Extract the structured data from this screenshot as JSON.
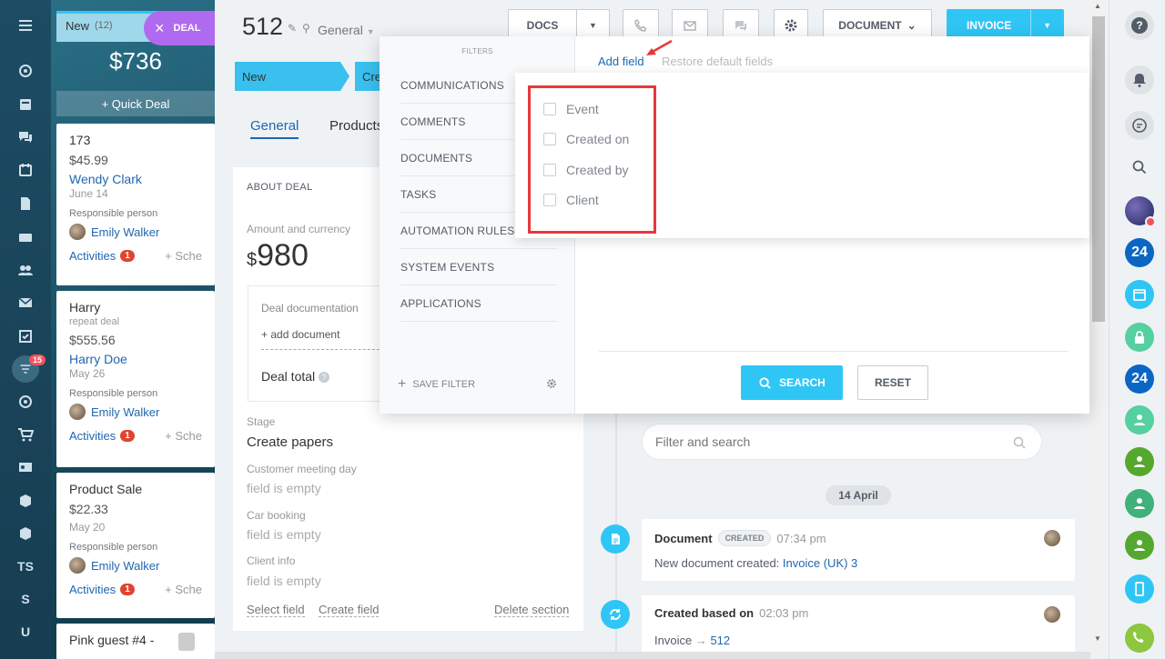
{
  "left_nav": {
    "badge": "15",
    "ts_label": "TS",
    "s_label": "S",
    "u_label": "U"
  },
  "kanban": {
    "column_title": "New",
    "column_count": "(12)",
    "total": "$736",
    "quick_deal": "+ Quick Deal",
    "deal_chip": "DEAL",
    "cards": [
      {
        "title": "173",
        "price": "$45.99",
        "contact": "Wendy Clark",
        "date": "June 14",
        "resp_label": "Responsible person",
        "resp_name": "Emily Walker",
        "activities": "Activities",
        "activities_count": "1",
        "schedule": "+ Sche"
      },
      {
        "title": "Harry",
        "subtitle": "repeat deal",
        "price": "$555.56",
        "contact": "Harry Doe",
        "date": "May 26",
        "resp_label": "Responsible person",
        "resp_name": "Emily Walker",
        "activities": "Activities",
        "activities_count": "1",
        "schedule": "+ Sche"
      },
      {
        "title": "Product Sale",
        "price": "$22.33",
        "date": "May 20",
        "resp_label": "Responsible person",
        "resp_name": "Emily Walker",
        "activities": "Activities",
        "activities_count": "1",
        "schedule": "+ Sche"
      },
      {
        "title": "Pink guest #4 -"
      }
    ]
  },
  "deal": {
    "id": "512",
    "category": "General",
    "buttons": {
      "docs": "DOCS",
      "document": "DOCUMENT",
      "invoice": "INVOICE"
    },
    "stages": [
      "New",
      "Cre"
    ],
    "tabs": [
      "General",
      "Products"
    ],
    "about": {
      "heading": "ABOUT DEAL",
      "amount_label": "Amount and currency",
      "currency": "$",
      "amount": "980",
      "doc_label": "Deal documentation",
      "add_document": "+ add document",
      "total_label": "Deal total",
      "stage_label": "Stage",
      "stage_value": "Create papers",
      "meeting_label": "Customer meeting day",
      "meeting_value": "field is empty",
      "car_label": "Car booking",
      "car_value": "field is empty",
      "client_label": "Client info",
      "client_value": "field is empty",
      "select_field": "Select field",
      "create_field": "Create field",
      "delete_section": "Delete section"
    }
  },
  "filter": {
    "header": "FILTERS",
    "items": [
      "COMMUNICATIONS",
      "COMMENTS",
      "DOCUMENTS",
      "TASKS",
      "AUTOMATION RULES A",
      "SYSTEM EVENTS",
      "APPLICATIONS"
    ],
    "save_filter": "SAVE FILTER",
    "add_field": "Add field",
    "restore": "Restore default fields",
    "fields": [
      "Event",
      "Created on",
      "Created by",
      "Client"
    ],
    "search": "SEARCH",
    "reset": "RESET"
  },
  "timeline": {
    "search_placeholder": "Filter and search",
    "date": "14 April",
    "entries": [
      {
        "title": "Document",
        "badge": "CREATED",
        "time": "07:34 pm",
        "text": "New document created:",
        "link": "Invoice (UK) 3"
      },
      {
        "title": "Created based on",
        "time": "02:03 pm",
        "text": "Invoice",
        "arrow": "→",
        "link": "512"
      }
    ]
  },
  "right_bar": {
    "number_label": "24"
  },
  "colors": {
    "accent": "#2fc6f6",
    "highlight": "#e8373b",
    "link": "#2067b0",
    "kanban_bg": "#1d4c63"
  }
}
